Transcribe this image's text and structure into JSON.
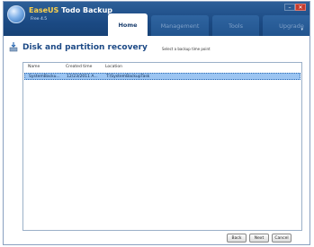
{
  "window": {
    "brand": "EaseUS",
    "app_title": "Todo Backup",
    "app_subtitle": "Free 4.5",
    "controls": {
      "minimize": "–",
      "close": "✕"
    }
  },
  "tabs": [
    {
      "label": "Home",
      "active": true
    },
    {
      "label": "Management",
      "active": false
    },
    {
      "label": "Tools",
      "active": false
    },
    {
      "label": "Upgrade",
      "active": false
    }
  ],
  "page": {
    "title": "Disk and partition recovery",
    "subtitle": "Select a backup time point"
  },
  "table": {
    "columns": [
      "Name",
      "Created time",
      "Location"
    ],
    "rows": [
      {
        "name": "SystemBacku...",
        "created": "12/23/2011 A...",
        "location": "T:\\SystemBackupTask",
        "selected": true
      }
    ]
  },
  "buttons": {
    "back": "Back",
    "next": "Next",
    "cancel": "Cancel"
  },
  "colors": {
    "titlebar": "#1b4a84",
    "heading": "#1d4a86",
    "selection": "#9cc5f2"
  }
}
